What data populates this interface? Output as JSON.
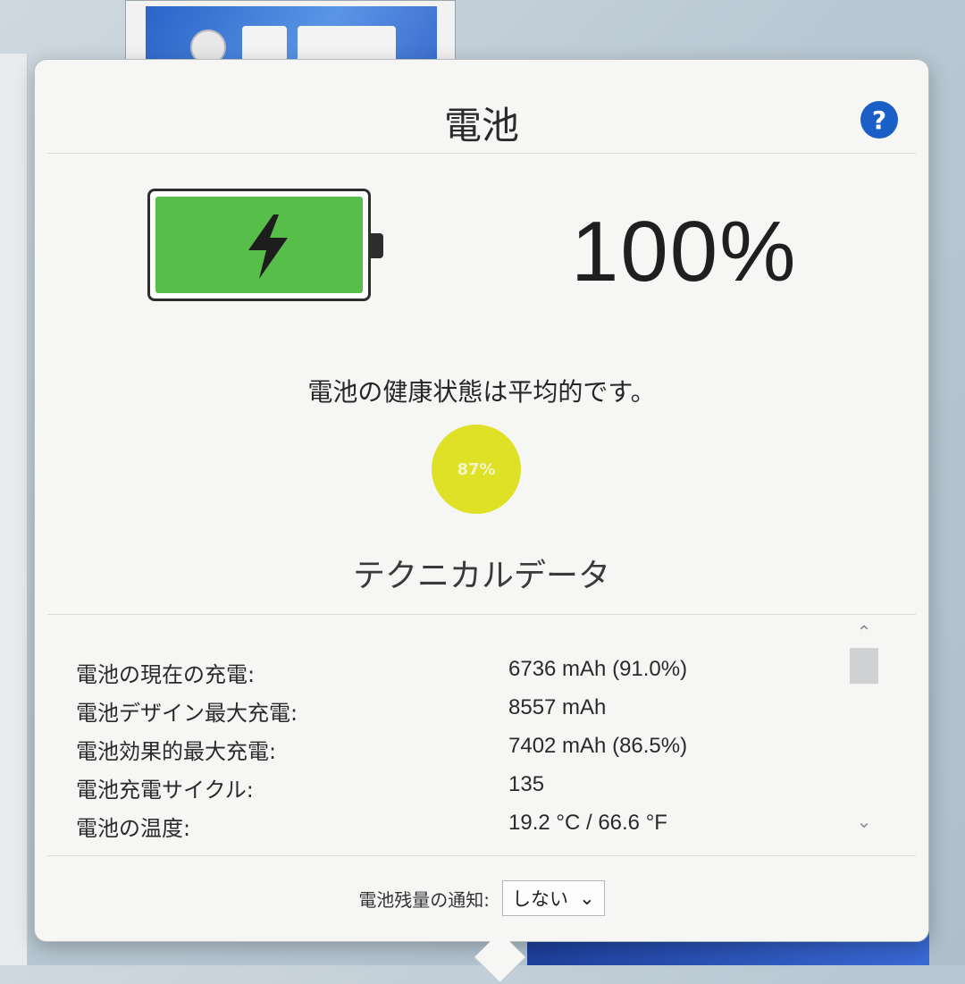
{
  "popup": {
    "title": "電池",
    "help_label": "?",
    "battery": {
      "level_percent": 100,
      "percent_text": "100%",
      "fill_color": "#58be4a"
    },
    "health": {
      "text": "電池の健康状態は平均的です。",
      "percent_text": "87%",
      "color": "#dfe127"
    },
    "technical": {
      "title": "テクニカルデータ",
      "rows": [
        {
          "label": "電池の現在の充電:",
          "value": "6736 mAh (91.0%)"
        },
        {
          "label": "電池デザイン最大充電:",
          "value": "8557 mAh"
        },
        {
          "label": "電池効果的最大充電:",
          "value": "7402 mAh (86.5%)"
        },
        {
          "label": "電池充電サイクル:",
          "value": "135"
        },
        {
          "label": "電池の温度:",
          "value": "19.2 °C / 66.6 °F"
        }
      ]
    },
    "notification": {
      "label": "電池残量の通知:",
      "selected": "しない"
    }
  },
  "icons": {
    "scroll_up": "⌃",
    "scroll_down": "⌄",
    "dropdown": "⌄"
  }
}
